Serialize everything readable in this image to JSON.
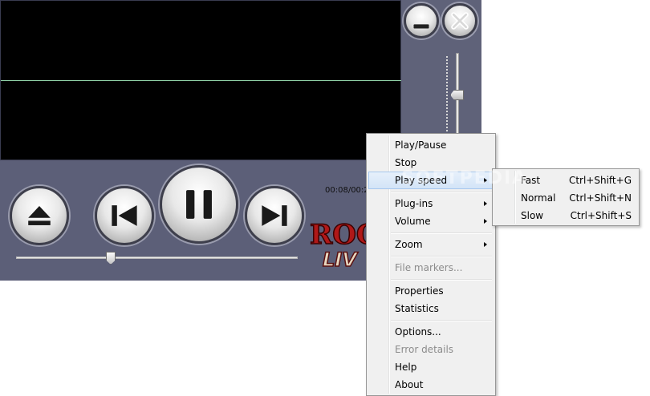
{
  "player": {
    "time_display": "00:08/00:2",
    "colors": {
      "body": "#5c5f78",
      "video": "#000000",
      "waveform": "#8fd0a6"
    },
    "buttons": {
      "minimize": "minimize-icon",
      "close": "close-icon",
      "eject": "eject-icon",
      "previous": "skip-back-icon",
      "pause": "pause-icon",
      "next": "skip-forward-icon"
    },
    "logo_text": {
      "line1": "ROC",
      "line2": "LIV"
    }
  },
  "watermark": "SOFTPEDIA",
  "context_menu": {
    "items": [
      {
        "label": "Play/Pause"
      },
      {
        "label": "Stop"
      },
      {
        "label": "Play speed"
      },
      {
        "label": "Plug-ins"
      },
      {
        "label": "Volume"
      },
      {
        "label": "Zoom"
      },
      {
        "label": "File markers..."
      },
      {
        "label": "Properties"
      },
      {
        "label": "Statistics"
      },
      {
        "label": "Options..."
      },
      {
        "label": "Error details"
      },
      {
        "label": "Help"
      },
      {
        "label": "About"
      }
    ],
    "submenu_play_speed": [
      {
        "label": "Fast",
        "shortcut": "Ctrl+Shift+G"
      },
      {
        "label": "Normal",
        "shortcut": "Ctrl+Shift+N"
      },
      {
        "label": "Slow",
        "shortcut": "Ctrl+Shift+S"
      }
    ]
  }
}
